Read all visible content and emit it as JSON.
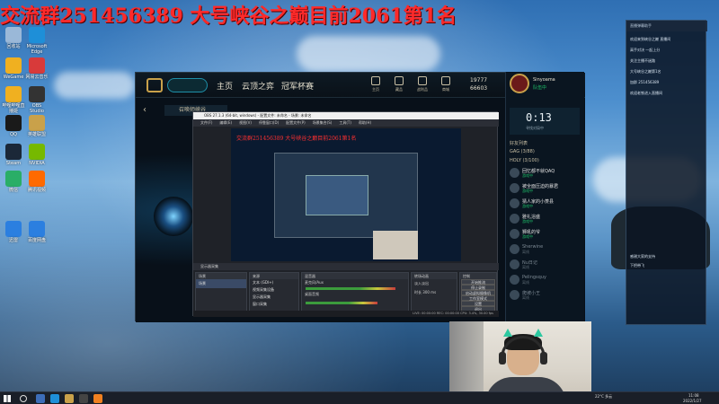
{
  "overlay_title": "交流群251456389 大号峡谷之巅目前2061第1名",
  "desktop": {
    "icons": [
      {
        "label": "回收站",
        "color": "#9ab8d8"
      },
      {
        "label": "Microsoft Edge",
        "color": "#1e8fd8"
      },
      {
        "label": "WeGame",
        "color": "#f0b020"
      },
      {
        "label": "网易云音乐",
        "color": "#d83a3a"
      },
      {
        "label": "哔哩哔哩直播姬",
        "color": "#f0b020"
      },
      {
        "label": "OBS Studio",
        "color": "#333333"
      },
      {
        "label": "QQ",
        "color": "#1a1a1a"
      },
      {
        "label": "英雄联盟",
        "color": "#c9a14a"
      },
      {
        "label": "Steam",
        "color": "#1b2838"
      },
      {
        "label": "NVIDIA",
        "color": "#76b900"
      },
      {
        "label": "微信",
        "color": "#2aae67"
      },
      {
        "label": "腾讯视频",
        "color": "#ff6a00"
      },
      {
        "label": "迅雷",
        "color": "#2b7fe0"
      },
      {
        "label": "百度网盘",
        "color": "#2b7fe0"
      }
    ]
  },
  "lol": {
    "nav": [
      "主页",
      "云顶之弈",
      "冠军杯赛"
    ],
    "icons": [
      "主页",
      "藏品",
      "战利品",
      "商城"
    ],
    "currency": {
      "rp": "19777",
      "be": "66603"
    },
    "summoner_name": "Sinyoama",
    "summoner_status": "队伍中",
    "back_label": "‹",
    "tab_label": "召唤师峡谷",
    "timer": "0:13",
    "timer_sub": "寻找对局中",
    "friends_header": "好友列表",
    "group_1": "GAG (3/88)",
    "group_2": "HOLY (3/100)",
    "friends": [
      {
        "name": "回忆都不就QAQ",
        "status": "游戏中",
        "online": true
      },
      {
        "name": "被全面压迫的暴君",
        "status": "游戏中",
        "online": true
      },
      {
        "name": "猜人家的小菱县",
        "status": "游戏中",
        "online": true
      },
      {
        "name": "雅礼浴盛",
        "status": "游戏中",
        "online": true
      },
      {
        "name": "狮吼的爷",
        "status": "游戏中",
        "online": true
      },
      {
        "name": "Sherwine",
        "status": "离线",
        "online": false
      },
      {
        "name": "Nu日记",
        "status": "离线",
        "online": false
      },
      {
        "name": "Pelingsquy",
        "status": "离线",
        "online": false
      },
      {
        "name": "爬坡小王",
        "status": "离线",
        "online": false
      }
    ]
  },
  "obs": {
    "title": "OBS 27.1.3 (64-bit, windows) - 配置文件: 未命名 - 场景: 未命名",
    "menu": [
      "文件(F)",
      "编辑(E)",
      "视图(V)",
      "停靠窗口(D)",
      "配置文件(P)",
      "场景集合(S)",
      "工具(T)",
      "帮助(H)"
    ],
    "preview_overlay": "交流群251456389 大号峡谷之巅目前2061第1名",
    "source_bar": "显示器采集",
    "docks": [
      "场景",
      "来源",
      "混音器",
      "转场动画",
      "控制"
    ],
    "scenes": [
      "场景"
    ],
    "sources": [
      "文本 (GDI+)",
      "视频采集设备",
      "显示器采集",
      "窗口采集"
    ],
    "mixer": [
      "麦克风/Aux",
      "桌面音频"
    ],
    "transition": [
      "淡入淡出",
      "时长 300 ms"
    ],
    "controls": [
      "开始推流",
      "停止录制",
      "启动虚拟摄像机",
      "工作室模式",
      "设置",
      "退出"
    ],
    "status": "LIVE: 00:00:00  REC: 00:00:00  CPU: 3.4%, 30.00 fps"
  },
  "chat": {
    "header": "直播弹幕助手",
    "lines": [
      "欢迎来到峡谷之巅 直播间",
      "高手对决 一起上分",
      "关注主播不迷路",
      "大号峡谷之巅第1名",
      "加群 251456389",
      "欢迎老铁进入直播间",
      "感谢大家的支持",
      "下把带飞"
    ]
  },
  "taskbar": {
    "weather": "22°C 多云",
    "clock": "11:08",
    "date": "2022/1/27"
  }
}
